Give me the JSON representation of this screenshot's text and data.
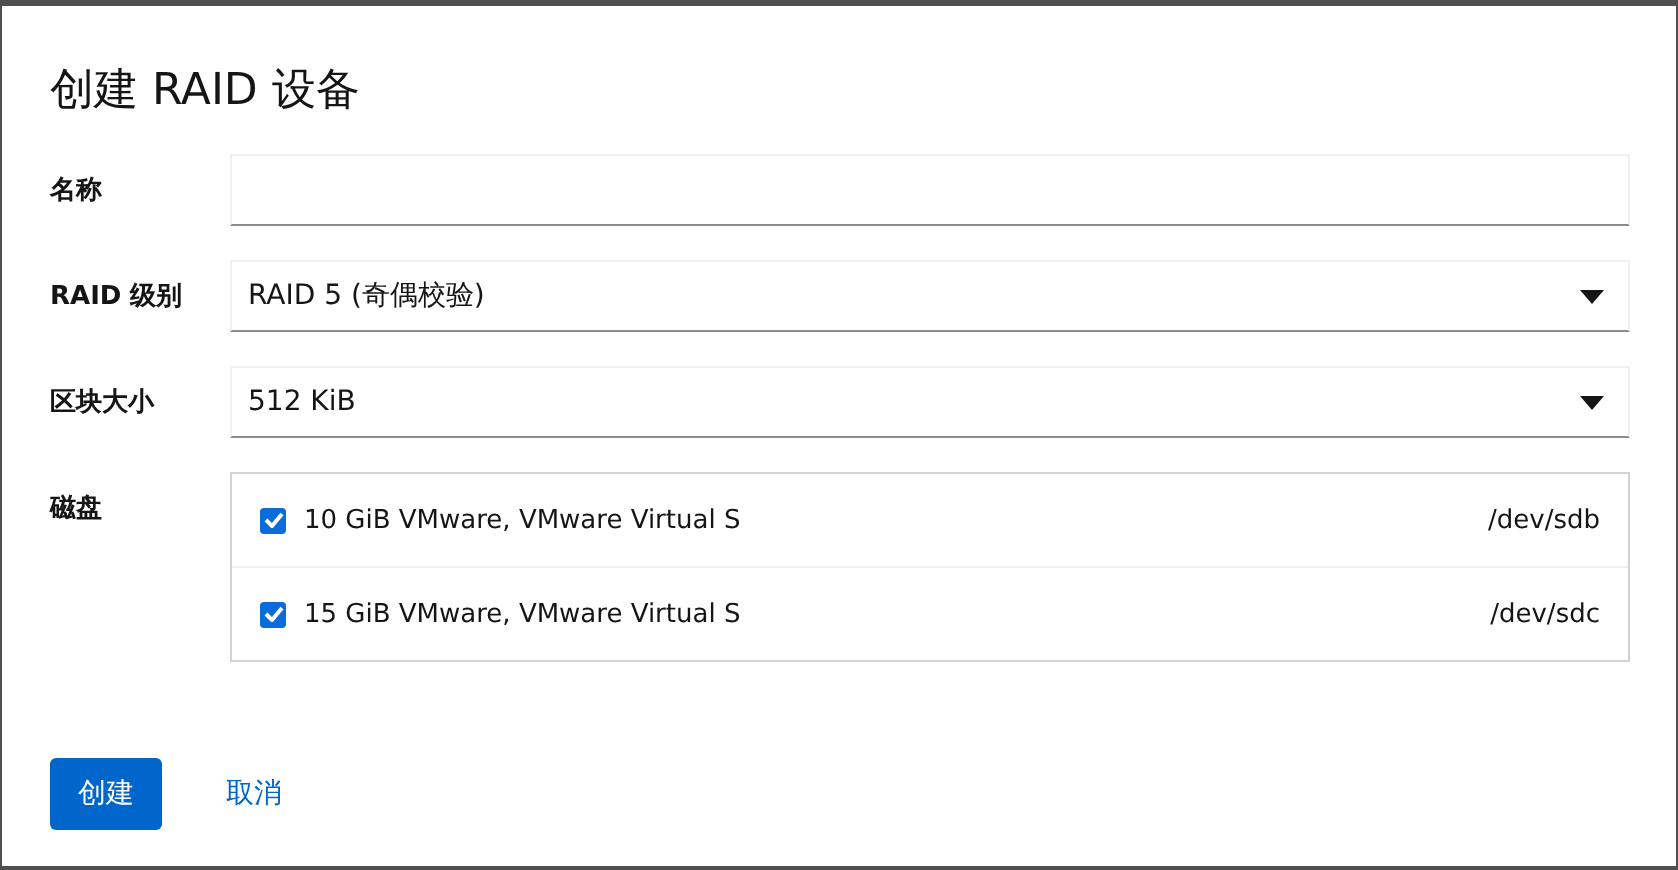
{
  "dialog": {
    "title": "创建 RAID 设备"
  },
  "fields": [
    {
      "kind": "text",
      "label": "名称"
    },
    {
      "kind": "select",
      "label": "RAID 级别",
      "value": "RAID 5 (奇偶校验)"
    },
    {
      "kind": "select",
      "label": "区块大小",
      "value": "512 KiB"
    }
  ],
  "disks": {
    "label": "磁盘",
    "items": [
      {
        "name": "10 GiB VMware, VMware Virtual S",
        "device": "/dev/sdb",
        "checked": true
      },
      {
        "name": "15 GiB VMware, VMware Virtual S",
        "device": "/dev/sdc",
        "checked": true
      }
    ]
  },
  "buttons": [
    {
      "label": "创建",
      "kind": "primary"
    },
    {
      "label": "取消",
      "kind": "link"
    }
  ]
}
